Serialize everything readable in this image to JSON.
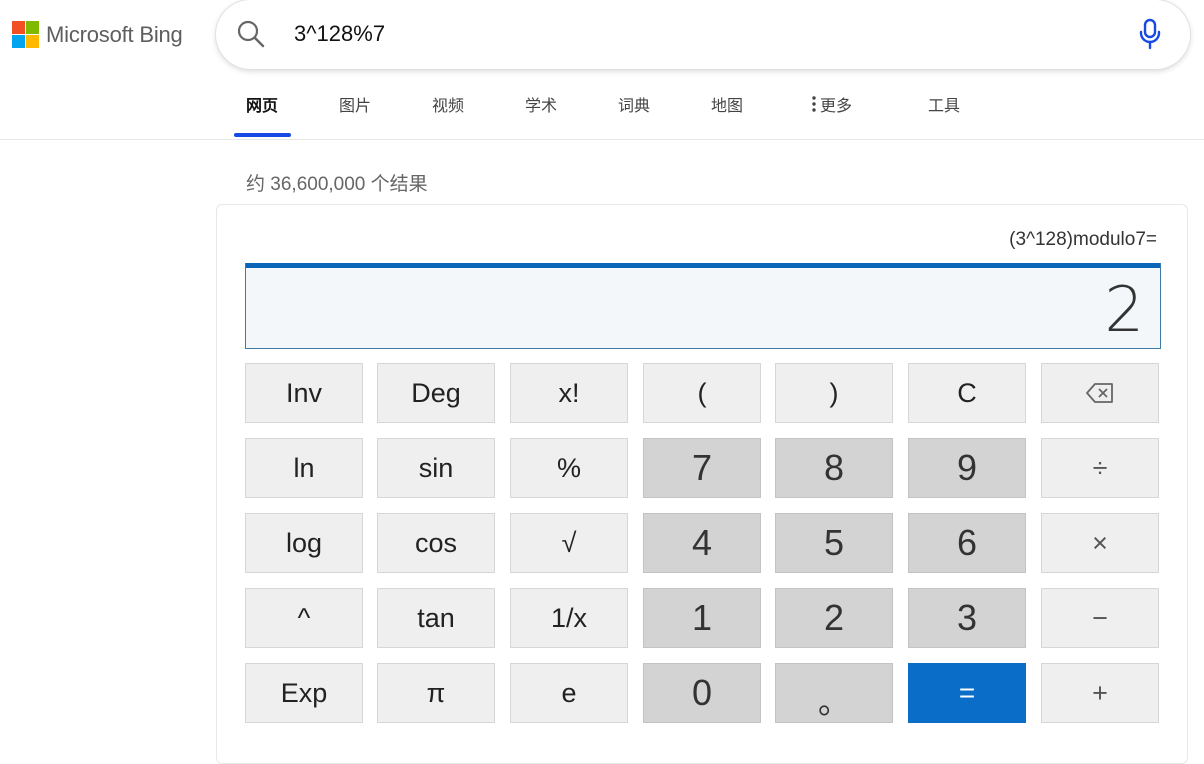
{
  "header": {
    "brand": "Microsoft Bing",
    "brand_colors": [
      "#f25022",
      "#7fba00",
      "#00a4ef",
      "#ffb900"
    ],
    "search_query": "3^128%7",
    "accent": "#174ae4",
    "icons": {
      "search": "search-icon",
      "mic": "microphone-icon"
    }
  },
  "tabs": [
    {
      "label": "网页",
      "active": true
    },
    {
      "label": "图片",
      "active": false
    },
    {
      "label": "视频",
      "active": false
    },
    {
      "label": "学术",
      "active": false
    },
    {
      "label": "词典",
      "active": false
    },
    {
      "label": "地图",
      "active": false
    },
    {
      "label": "更多",
      "active": false
    },
    {
      "label": "工具",
      "active": false
    }
  ],
  "results": {
    "count_text": "约 36,600,000 个结果"
  },
  "calculator": {
    "expression": "(3^128)modulo7=",
    "display_value": "2",
    "equals_color": "#0a6ec9",
    "keys": [
      [
        "Inv",
        "Deg",
        "x!",
        "(",
        ")",
        "C",
        "⌫"
      ],
      [
        "ln",
        "sin",
        "%",
        "7",
        "8",
        "9",
        "÷"
      ],
      [
        "log",
        "cos",
        "√",
        "4",
        "5",
        "6",
        "×"
      ],
      [
        "^",
        "tan",
        "1/x",
        "1",
        "2",
        "3",
        "−"
      ],
      [
        "Exp",
        "π",
        "e",
        "0",
        "。",
        "=",
        "+"
      ]
    ]
  }
}
